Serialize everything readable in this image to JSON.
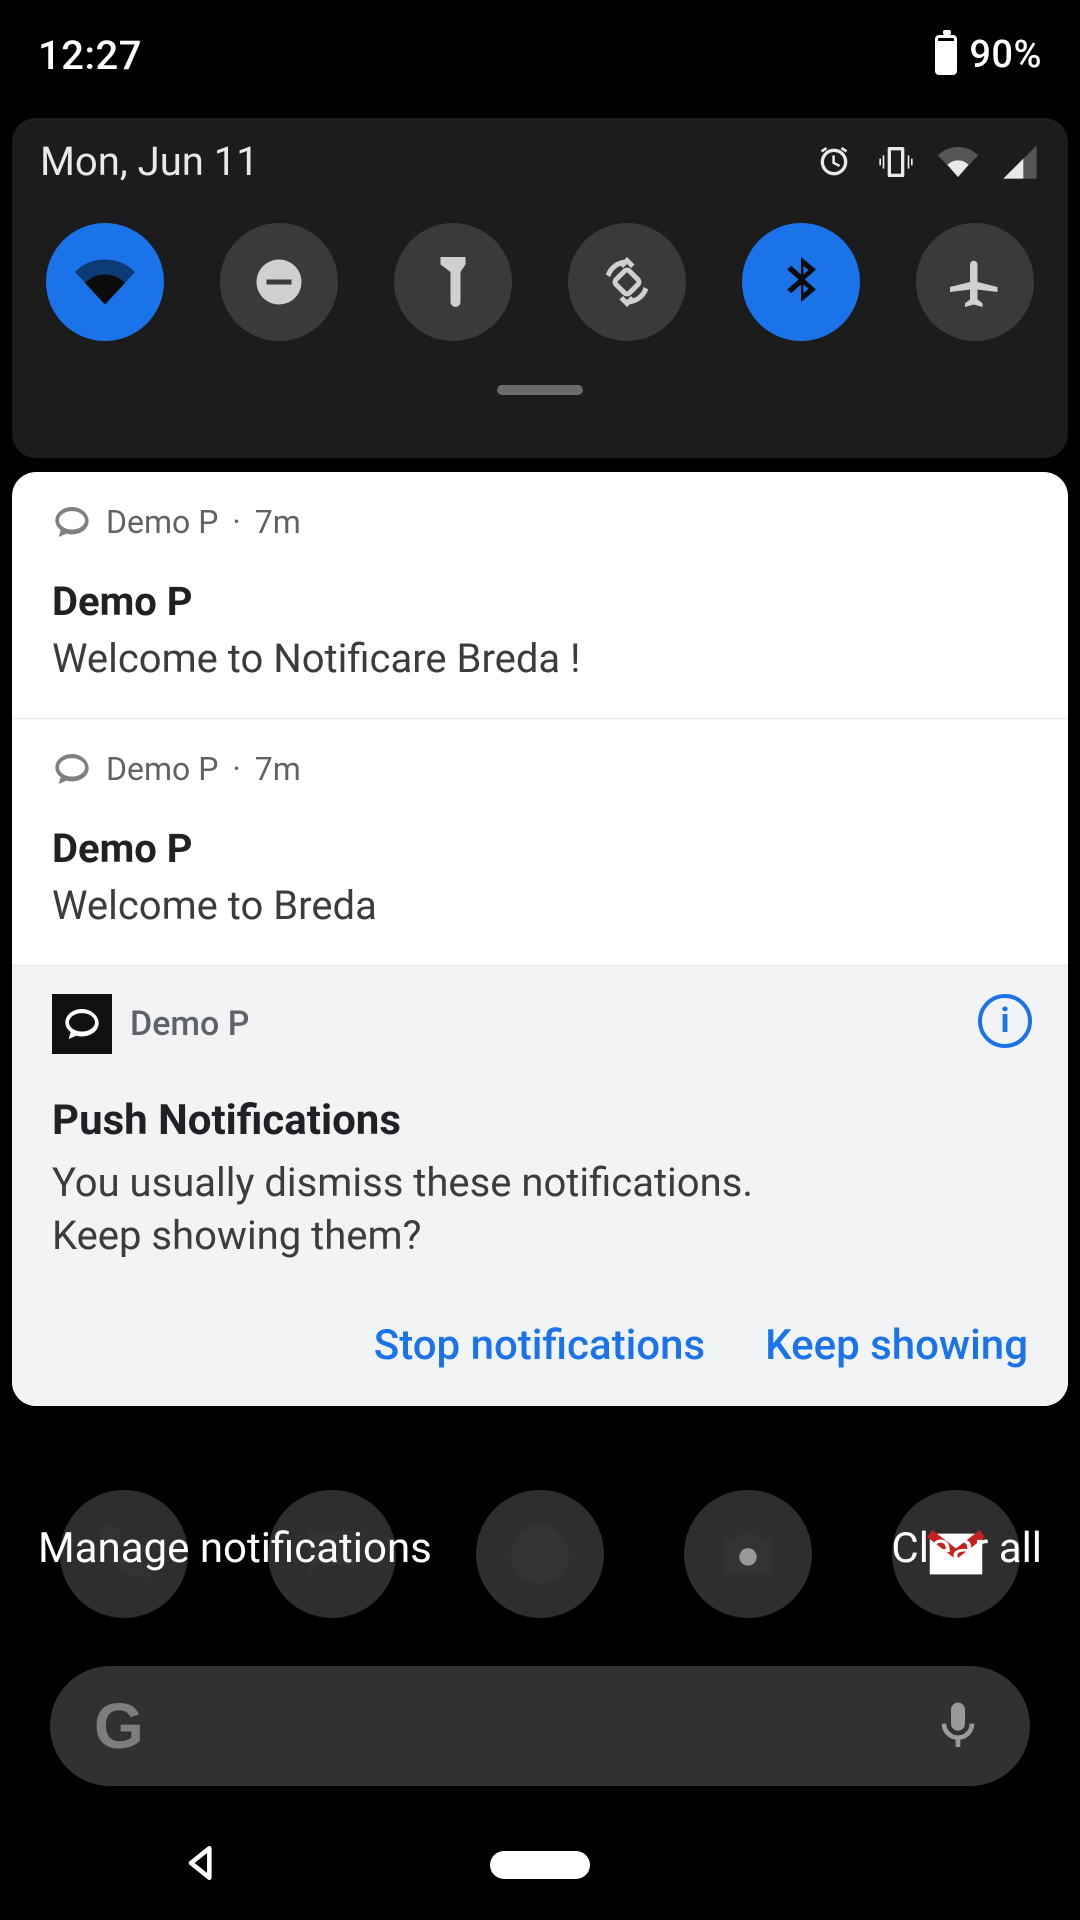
{
  "status": {
    "time": "12:27",
    "battery_pct": "90%"
  },
  "qs": {
    "date": "Mon, Jun 11",
    "tiles": [
      "wifi",
      "dnd",
      "flashlight",
      "rotate",
      "bluetooth",
      "airplane"
    ]
  },
  "notifications": [
    {
      "app": "Demo P",
      "age": "7m",
      "title": "Demo P",
      "body": "Welcome to Notificare Breda  !"
    },
    {
      "app": "Demo P",
      "age": "7m",
      "title": "Demo P",
      "body": "Welcome to Breda"
    }
  ],
  "system_prompt": {
    "app": "Demo P",
    "heading": "Push Notifications",
    "body_line1": "You usually dismiss these notifications.",
    "body_line2": "Keep showing them?",
    "action_stop": "Stop notifications",
    "action_keep": "Keep showing"
  },
  "footer": {
    "manage": "Manage notifications",
    "clear": "Clear all"
  }
}
